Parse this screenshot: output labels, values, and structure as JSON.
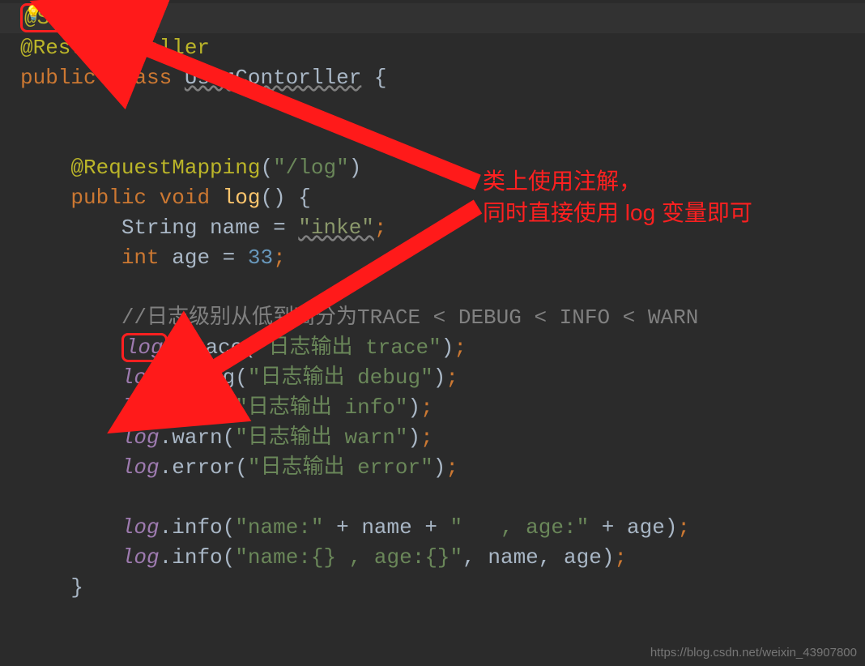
{
  "icons": {
    "bulb": "💡"
  },
  "code": {
    "slf4j": "@Slf4j",
    "restController": "@RestController",
    "public": "public",
    "class": "class",
    "className": "UserContorller",
    "lbrace": " {",
    "reqMap": "@RequestMapping",
    "reqMapArg": "\"/log\"",
    "void": "void",
    "logMethod": "log",
    "mSig": "() {",
    "stringType": "String ",
    "nameVar": "name",
    "eq": " = ",
    "nameVal": "\"inke\"",
    "intType": "int ",
    "ageVar": "age",
    "ageVal": "33",
    "semi": ";",
    "comment": "//日志级别从低到高分为TRACE < DEBUG < INFO < WARN",
    "logVar": "log",
    "dot": ".",
    "trace": "trace",
    "debug": "debug",
    "info": "info",
    "warn": "warn",
    "error": "error",
    "traceArg": "\"日志输出 trace\"",
    "debugArg": "\"日志输出 debug\"",
    "infoArg": "\"日志输出 info\"",
    "warnArg": "\"日志输出 warn\"",
    "errorArg": "\"日志输出 error\"",
    "lp": "(",
    "rp": ")",
    "infoConcat1": "\"name:\"",
    "plus": " + ",
    "infoConcat2": "\"   , age:\"",
    "infoFmt": "\"name:{} , age:{}\"",
    "comma": ", ",
    "rbrace": "}"
  },
  "callout": {
    "line1": "类上使用注解，",
    "line2": "同时直接使用 log 变量即可"
  },
  "watermark": "https://blog.csdn.net/weixin_43907800"
}
